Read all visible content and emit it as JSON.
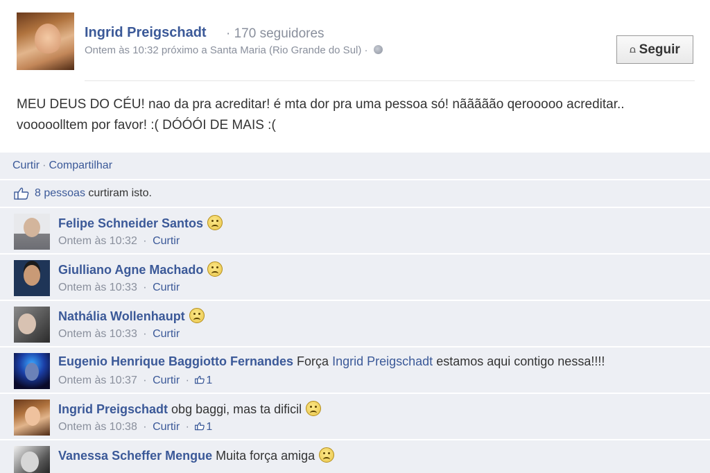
{
  "post": {
    "author": "Ingrid Preigschadt",
    "followers": "· 170 seguidores",
    "meta": "Ontem às 10:32 próximo a Santa Maria (Rio Grande do Sul) ·",
    "follow_label": "Seguir",
    "text_line1": "MEU DEUS DO CÉU! nao da pra acreditar! é mta dor pra uma pessoa só! nããããão qerooooo acreditar..",
    "text_line2": "vooooolltem por favor! :( DÓÓÓI DE MAIS :("
  },
  "actions": {
    "like": "Curtir",
    "share": "Compartilhar"
  },
  "likes": {
    "count_link": "8 pessoas",
    "suffix": "curtiram isto."
  },
  "comments": [
    {
      "author": "Felipe Schneider Santos",
      "text": "",
      "time": "Ontem às 10:32",
      "like_label": "Curtir",
      "likes": ""
    },
    {
      "author": "Giulliano Agne Machado",
      "text": "",
      "time": "Ontem às 10:33",
      "like_label": "Curtir",
      "likes": ""
    },
    {
      "author": "Nathália Wollenhaupt",
      "text": "",
      "time": "Ontem às 10:33",
      "like_label": "Curtir",
      "likes": ""
    },
    {
      "author": "Eugenio Henrique Baggiotto Fernandes",
      "text_before": "Força",
      "mention": "Ingrid Preigschadt",
      "text_after": "estamos aqui contigo nessa!!!!",
      "time": "Ontem às 10:37",
      "like_label": "Curtir",
      "likes": "1"
    },
    {
      "author": "Ingrid Preigschadt",
      "text": "obg baggi, mas ta dificil",
      "time": "Ontem às 10:38",
      "like_label": "Curtir",
      "likes": "1"
    },
    {
      "author": "Vanessa Scheffer Mengue",
      "text": "Muita força amiga",
      "time": "",
      "like_label": "",
      "likes": ""
    }
  ],
  "icons": {
    "rss": "rss-icon",
    "globe": "globe-icon",
    "thumb": "thumbs-up-icon",
    "emoji": "sad-face-emoji"
  },
  "colors": {
    "link": "#3b5998",
    "meta": "#898f9c",
    "feedback_bg": "#edeff4"
  }
}
